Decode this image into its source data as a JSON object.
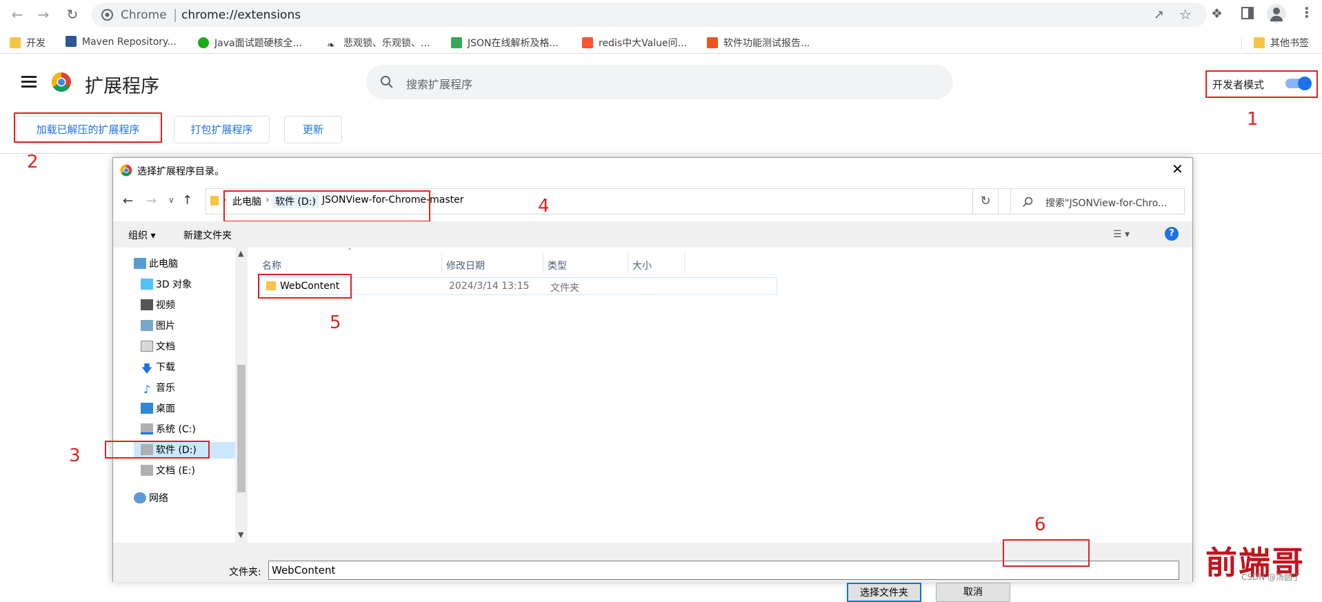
{
  "browser": {
    "site_label": "Chrome",
    "separator": "|",
    "url": "chrome://extensions",
    "bookmarks": [
      {
        "label": "开发",
        "icon": "folder-icon"
      },
      {
        "label": "Maven Repository...",
        "icon": "maven-icon"
      },
      {
        "label": "Java面试题硬核全...",
        "icon": "wechat-icon"
      },
      {
        "label": "悲观锁、乐观锁、...",
        "icon": "feather-icon"
      },
      {
        "label": "JSON在线解析及格...",
        "icon": "json-icon"
      },
      {
        "label": "redis中大Value问...",
        "icon": "csdn-c-icon"
      },
      {
        "label": "软件功能测试报告...",
        "icon": "s-icon"
      }
    ],
    "other_bookmarks": "其他书签"
  },
  "extensions": {
    "title": "扩展程序",
    "search_placeholder": "搜索扩展程序",
    "dev_mode_label": "开发者模式",
    "dev_mode_on": true,
    "buttons": {
      "load_unpacked": "加载已解压的扩展程序",
      "pack": "打包扩展程序",
      "update": "更新"
    }
  },
  "dialog": {
    "title": "选择扩展程序目录。",
    "breadcrumbs": [
      "此电脑",
      "软件 (D:)",
      "JSONView-for-Chrome-master"
    ],
    "search_placeholder": "搜索\"JSONView-for-Chro...",
    "commands": {
      "organize": "组织 ▾",
      "new_folder": "新建文件夹"
    },
    "nav_items": [
      {
        "label": "此电脑",
        "icon": "pc-icon"
      },
      {
        "label": "3D 对象",
        "icon": "cube-3d-icon"
      },
      {
        "label": "视频",
        "icon": "video-icon"
      },
      {
        "label": "图片",
        "icon": "picture-icon"
      },
      {
        "label": "文档",
        "icon": "document-icon"
      },
      {
        "label": "下载",
        "icon": "download-icon"
      },
      {
        "label": "音乐",
        "icon": "music-icon"
      },
      {
        "label": "桌面",
        "icon": "desktop-icon"
      },
      {
        "label": "系统 (C:)",
        "icon": "drive-c-icon"
      },
      {
        "label": "软件 (D:)",
        "icon": "drive-d-icon",
        "selected": true
      },
      {
        "label": "文档 (E:)",
        "icon": "drive-e-icon"
      },
      {
        "label": "网络",
        "icon": "network-icon"
      }
    ],
    "columns": {
      "name": "名称",
      "modified": "修改日期",
      "type": "类型",
      "size": "大小"
    },
    "files": [
      {
        "name": "WebContent",
        "modified": "2024/3/14 13:15",
        "type": "文件夹",
        "size": ""
      }
    ],
    "footer": {
      "folder_label": "文件夹:",
      "folder_value": "WebContent",
      "select_button": "选择文件夹",
      "cancel_button": "取消"
    }
  },
  "annotations": [
    "1",
    "2",
    "3",
    "4",
    "5",
    "6"
  ],
  "watermark": {
    "text": "前端哥",
    "csdn": "CSDN @汤圆了"
  },
  "colors": {
    "accent": "#1a73e8",
    "annotation": "#e02020",
    "toggle_on": "#1a73e8"
  }
}
